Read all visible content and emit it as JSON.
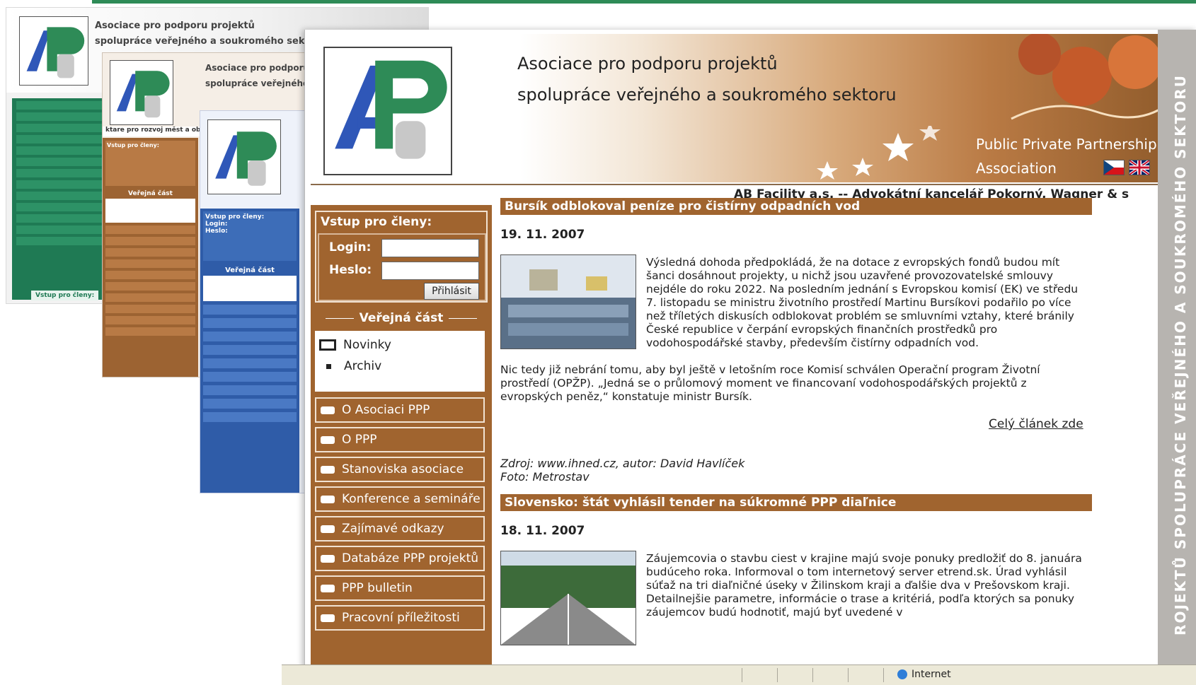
{
  "site": {
    "title_line1": "Asociace pro podporu projektů",
    "title_line2": "spolupráce veřejného a soukromého sektoru",
    "ppp_line1": "Public Private Partnership",
    "ppp_line2": "Association",
    "vertical_banner": "ROJEKTŮ SPOLUPRÁCE VEŘEJNÉHO A SOUKROMÉHO SEKTORU",
    "ticker": "AB Facility a.s. -- Advokátní kancelář Pokorný, Wagner & s",
    "accent_color": "#a0642f"
  },
  "login": {
    "title": "Vstup pro členy:",
    "login_label": "Login:",
    "password_label": "Heslo:",
    "button": "Přihlásit"
  },
  "public_section": {
    "title": "Veřejná část",
    "items": [
      "Novinky",
      "Archiv"
    ]
  },
  "menu": [
    "O Asociaci PPP",
    "O PPP",
    "Stanoviska asociace",
    "Konference a semináře",
    "Zajímavé odkazy",
    "Databáze PPP projektů",
    "PPP bulletin",
    "Pracovní příležitosti"
  ],
  "articles": [
    {
      "title": "Bursík odblokoval peníze pro čistírny odpadních vod",
      "date": "19. 11. 2007",
      "text": "Výsledná dohoda předpokládá, že na dotace z evropských fondů budou mít šanci dosáhnout projekty, u nichž jsou uzavřené provozovatelské smlouvy nejdéle do roku 2022. Na posledním jednání s Evropskou komisí (EK) ve středu 7. listopadu se ministru životního prostředí Martinu Bursíkovi podařilo po více než tříletých diskusích odblokovat problém se smluvními vztahy, které bránily České republice v čerpání evropských finančních prostředků pro vodohospodářské stavby, především čistírny odpadních vod.",
      "text2": "Nic tedy již nebrání tomu, aby byl ještě v letošním roce Komisí schválen Operační program Životní prostředí (OPŽP). „Jedná se o průlomový moment ve financovaní vodohospodářských projektů z evropských peněz,“ konstatuje ministr Bursík.",
      "more": "Celý článek zde",
      "source": "Zdroj: www.ihned.cz, autor: David Havlíček",
      "photo": "Foto: Metrostav"
    },
    {
      "title": "Slovensko: štát vyhlásil tender na súkromné PPP diaľnice",
      "date": "18. 11. 2007",
      "text": "Záujemcovia o stavbu ciest v krajine majú svoje ponuky predložiť do 8. januára budúceho roka. Informoval o tom internetový server etrend.sk. Úrad vyhlásil súťaž na tri diaľničné úseky v Žilinskom kraji a ďalšie dva v Prešovskom kraji. Detailnejšie parametre, informácie o trase a kritériá, podľa ktorých sa ponuky záujemcov budú hodnotiť, majú byť uvedené v"
    }
  ],
  "status_bar": {
    "zone": "Internet"
  },
  "bg_green": {
    "title1": "Asociace pro podporu projektů",
    "title2": "spolupráce veřejného a soukromého sektoru",
    "login": "Vstup pro členy:"
  },
  "bg_brown": {
    "title1": "Asociace pro podporu",
    "title2": "spolupráce veřejného",
    "bar": "ktare pro rozvoj měst a ob",
    "login": "Vstup pro členy:",
    "section": "Veřejná část"
  },
  "bg_blue": {
    "login": "Vstup pro členy:",
    "login_label": "Login:",
    "password_label": "Heslo:",
    "section": "Veřejná část"
  }
}
